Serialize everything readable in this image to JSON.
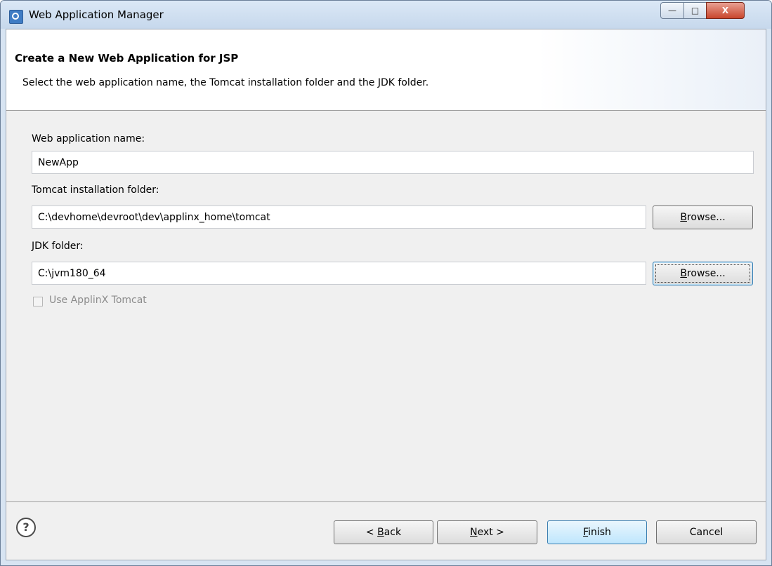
{
  "window": {
    "title": "Web Application Manager",
    "close_glyph": "X",
    "min_glyph": "—",
    "max_glyph": "□"
  },
  "header": {
    "title": "Create a New Web Application for JSP",
    "description": "Select the web application name, the Tomcat installation folder and the JDK folder."
  },
  "form": {
    "app_name_label": "Web application name:",
    "app_name_value": "NewApp",
    "tomcat_label": "Tomcat installation folder:",
    "tomcat_value": "C:\\devhome\\devroot\\dev\\applinx_home\\tomcat",
    "jdk_label": "JDK folder:",
    "jdk_value": "C:\\jvm180_64",
    "browse_first": "B",
    "browse_rest": "rowse...",
    "use_tomcat_label": "Use ApplinX Tomcat"
  },
  "footer": {
    "help_glyph": "?",
    "back_prefix": "< ",
    "back_first": "B",
    "back_rest": "ack",
    "next_first": "N",
    "next_rest": "ext >",
    "finish_first": "F",
    "finish_rest": "inish",
    "cancel": "Cancel"
  },
  "colors": {
    "accent": "#3c7fb1",
    "title_bar": "#c6d8ec",
    "close": "#c9462c"
  }
}
